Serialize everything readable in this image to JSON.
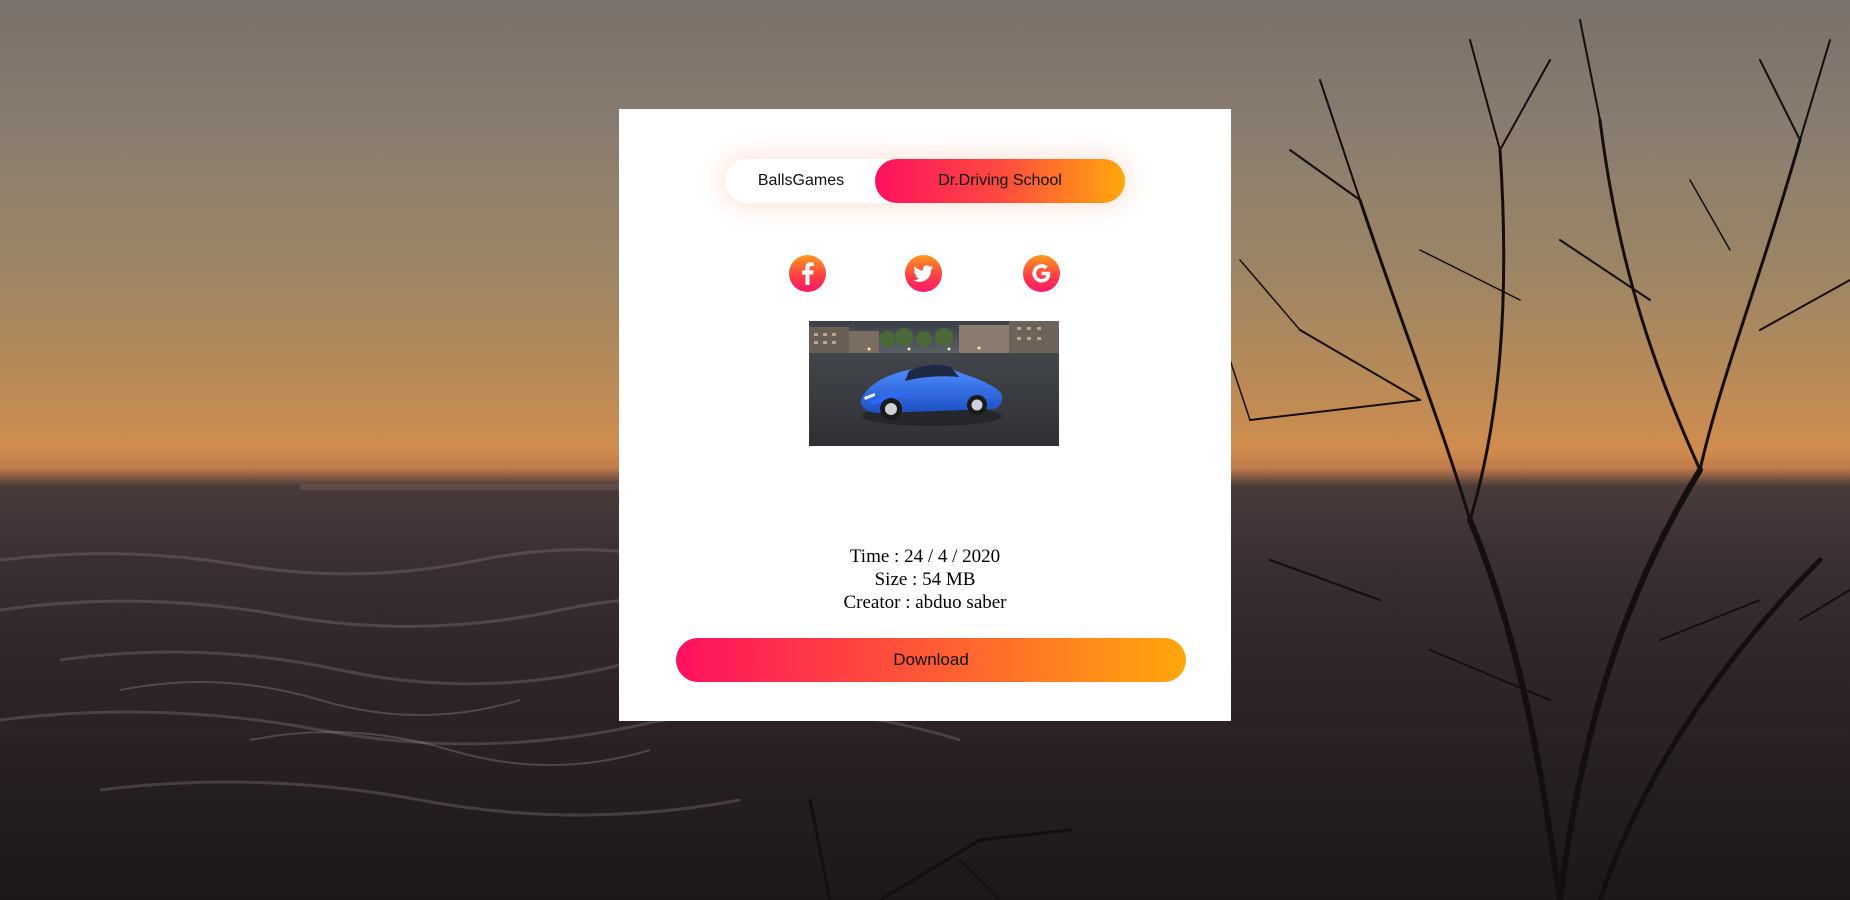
{
  "tabs": [
    {
      "label": "BallsGames",
      "active": false
    },
    {
      "label": "Dr.Driving School",
      "active": true
    }
  ],
  "social": [
    {
      "icon": "facebook-icon"
    },
    {
      "icon": "twitter-icon"
    },
    {
      "icon": "google-icon"
    }
  ],
  "game": {
    "image": "blue-sports-car-image"
  },
  "info": {
    "time": "Time : 24 / 4 / 2020",
    "size": "Size : 54 MB",
    "creator": "Creator : abduo saber"
  },
  "download_label": "Download",
  "colors": {
    "gradient_start": "#ff105f",
    "gradient_end": "#ffa80a",
    "card": "#ffffff"
  }
}
